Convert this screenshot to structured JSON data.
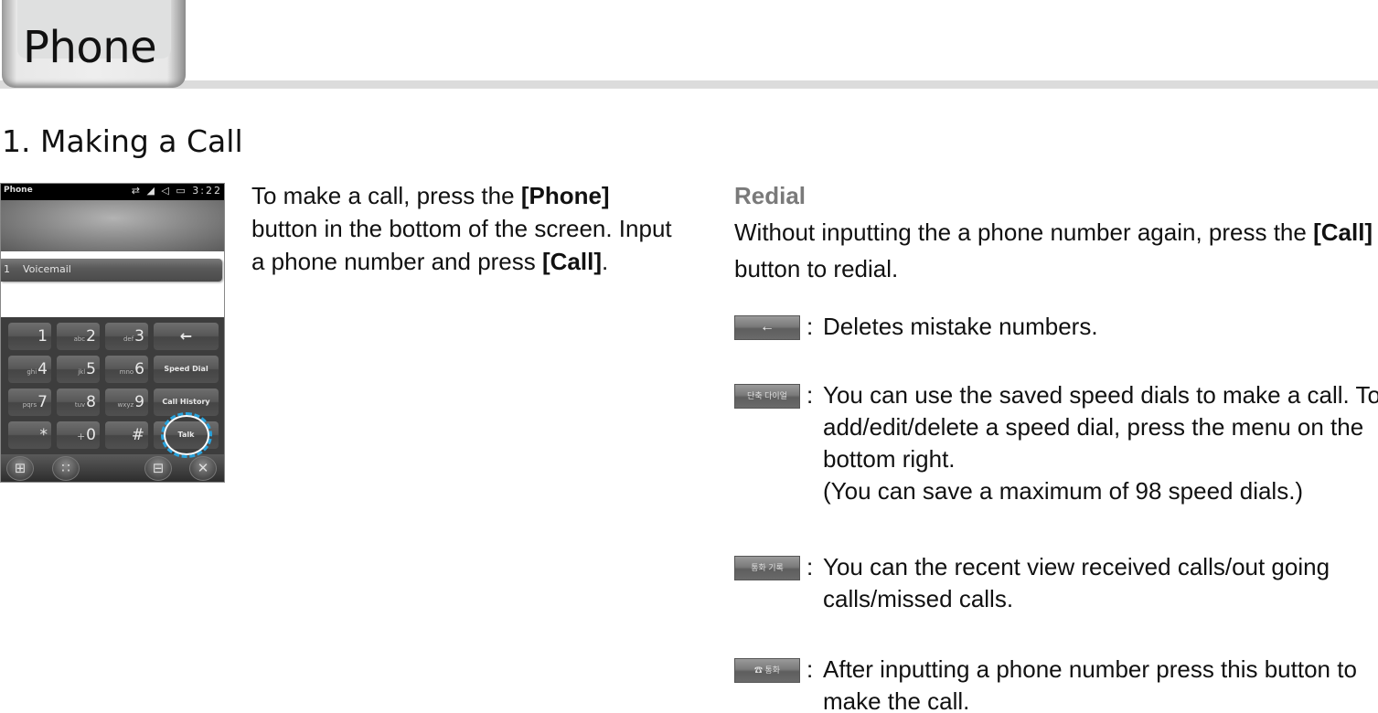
{
  "header": {
    "tab_title": "Phone"
  },
  "section": {
    "title": "1. Making a Call"
  },
  "phone_screen": {
    "status_title": "Phone",
    "status_icons": [
      "sync-icon",
      "signal-icon",
      "volume-icon",
      "battery-icon"
    ],
    "status_time": "3:22",
    "list_item": {
      "number": "1",
      "label": "Voicemail"
    },
    "keys": [
      {
        "letters": "",
        "digit": "1"
      },
      {
        "letters": "abc",
        "digit": "2"
      },
      {
        "letters": "def",
        "digit": "3"
      },
      {
        "label": "←"
      },
      {
        "letters": "ghi",
        "digit": "4"
      },
      {
        "letters": "jkl",
        "digit": "5"
      },
      {
        "letters": "mno",
        "digit": "6"
      },
      {
        "label": "Speed Dial"
      },
      {
        "letters": "pqrs",
        "digit": "7"
      },
      {
        "letters": "tuv",
        "digit": "8"
      },
      {
        "letters": "wxyz",
        "digit": "9"
      },
      {
        "label": "Call History"
      },
      {
        "letters": "",
        "digit": "*"
      },
      {
        "letters": "+",
        "digit": "0"
      },
      {
        "letters": "",
        "digit": "#"
      },
      {
        "label": "Talk"
      }
    ],
    "softkeys": [
      "windows-icon",
      "keypad-icon",
      "menu-icon",
      "close-icon"
    ],
    "softkey_glyphs": [
      "⊞",
      "∷",
      "⊟",
      "✕"
    ]
  },
  "intro": {
    "part1": "To make a call, press the ",
    "bold1": "[Phone]",
    "part2": " button in the bottom of the screen. Input a phone number and press ",
    "bold2": "[Call]",
    "part3": "."
  },
  "redial": {
    "title": "Redial",
    "part1": "Without inputting the a phone number again, press the ",
    "bold": "[Call]",
    "part2": " button to redial."
  },
  "items": [
    {
      "icon": "backspace-button-icon",
      "icon_glyph": "←",
      "colon": ":",
      "text": "Deletes mistake numbers."
    },
    {
      "icon": "speed-dial-button-icon",
      "icon_glyph": "단축 다이얼",
      "colon": ":",
      "text": "You can use the saved speed dials to make a call. To add/edit/delete a speed dial, press the menu on the bottom right.",
      "note": "(You can save a maximum of 98 speed dials.)"
    },
    {
      "icon": "call-history-button-icon",
      "icon_glyph": "통화 기록",
      "colon": ":",
      "text": "You can the recent view received calls/out going calls/missed calls."
    },
    {
      "icon": "call-button-icon",
      "icon_glyph": "☎ 통화",
      "colon": ":",
      "text": "After inputting a phone number press this button to make the call."
    }
  ]
}
